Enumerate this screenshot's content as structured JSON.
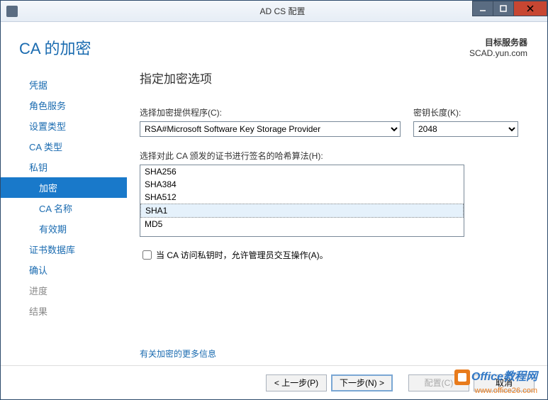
{
  "window": {
    "title": "AD CS 配置"
  },
  "header": {
    "pageTitle": "CA 的加密",
    "targetLabel": "目标服务器",
    "targetValue": "SCAD.yun.com"
  },
  "sidebar": {
    "items": [
      {
        "label": "凭据",
        "state": "done"
      },
      {
        "label": "角色服务",
        "state": "done"
      },
      {
        "label": "设置类型",
        "state": "done"
      },
      {
        "label": "CA 类型",
        "state": "done"
      },
      {
        "label": "私钥",
        "state": "done"
      },
      {
        "label": "加密",
        "state": "active",
        "sub": true
      },
      {
        "label": "CA 名称",
        "state": "done",
        "sub": true
      },
      {
        "label": "有效期",
        "state": "done",
        "sub": true
      },
      {
        "label": "证书数据库",
        "state": "done"
      },
      {
        "label": "确认",
        "state": "done"
      },
      {
        "label": "进度",
        "state": "pending"
      },
      {
        "label": "结果",
        "state": "pending"
      }
    ]
  },
  "main": {
    "sectionTitle": "指定加密选项",
    "providerLabel": "选择加密提供程序(C):",
    "providerValue": "RSA#Microsoft Software Key Storage Provider",
    "keyLenLabel": "密钥长度(K):",
    "keyLenValue": "2048",
    "hashLabel": "选择对此 CA 颁发的证书进行签名的哈希算法(H):",
    "hashOptions": [
      "SHA256",
      "SHA384",
      "SHA512",
      "SHA1",
      "MD5"
    ],
    "hashSelected": "SHA1",
    "checkboxLabel": "当 CA 访问私钥时，允许管理员交互操作(A)。",
    "checkboxChecked": false,
    "moreLink": "有关加密的更多信息"
  },
  "footer": {
    "prev": "< 上一步(P)",
    "next": "下一步(N) >",
    "configure": "配置(C)",
    "cancel": "取消"
  },
  "watermark": {
    "brand1": "Office",
    "brand2": "教程网",
    "url": "www.office26.com"
  }
}
